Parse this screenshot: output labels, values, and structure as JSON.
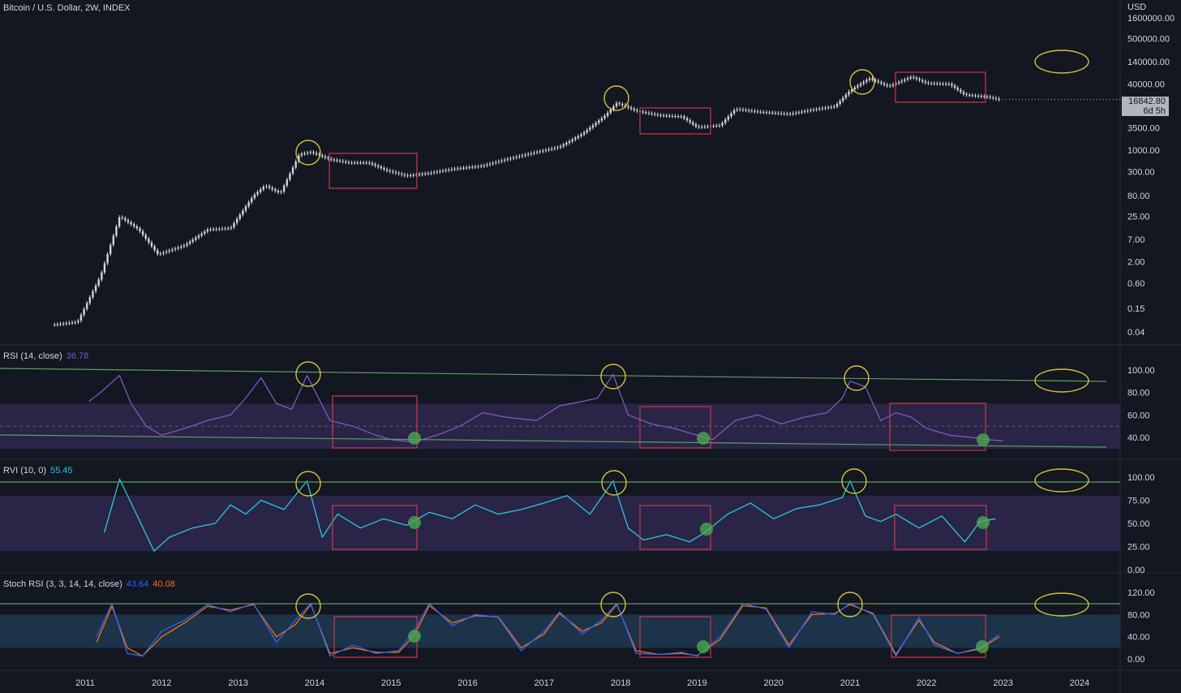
{
  "header": {
    "symbol_title": "Bitcoin / U.S. Dollar, 2W, INDEX",
    "currency": "USD",
    "last_price": "16842.80",
    "countdown": "6d 5h"
  },
  "colors": {
    "background": "#131722",
    "candle": "#d1d4dc",
    "rsi_line": "#7e57c2",
    "rvi_line": "#26c6da",
    "stoch_k": "#2962ff",
    "stoch_d": "#ff6d00",
    "trend_line": "#5b9b5b",
    "circle_highlight": "#d4c23a",
    "box_highlight": "#c93a45",
    "bottom_marker": "#4caf50",
    "band_fill": "#2a2547",
    "stoch_band_fill": "#1c3349"
  },
  "panes": {
    "rsi": {
      "label": "RSI (14, close)",
      "value": "36.78"
    },
    "rvi": {
      "label": "RVI (10, 0)",
      "value": "55.45"
    },
    "stoch": {
      "label": "Stoch RSI (3, 3, 14, 14, close)",
      "k_value": "43.64",
      "d_value": "40.08"
    }
  },
  "chart_data": [
    {
      "type": "line",
      "pane": "price",
      "title": "Bitcoin / U.S. Dollar, 2W, INDEX",
      "scale": "log",
      "y_ticks": [
        "1600000.00",
        "500000.00",
        "140000.00",
        "40000.00",
        "3500.00",
        "1000.00",
        "300.00",
        "80.00",
        "25.00",
        "7.00",
        "2.00",
        "0.60",
        "0.15",
        "0.04"
      ],
      "x_ticks": [
        "2011",
        "2012",
        "2013",
        "2014",
        "2015",
        "2016",
        "2017",
        "2018",
        "2019",
        "2020",
        "2021",
        "2022",
        "2023",
        "2024"
      ],
      "x": [
        2010.6,
        2010.9,
        2011.2,
        2011.45,
        2011.7,
        2011.95,
        2012.3,
        2012.6,
        2012.9,
        2013.2,
        2013.35,
        2013.55,
        2013.8,
        2013.95,
        2014.2,
        2014.45,
        2014.7,
        2014.95,
        2015.2,
        2015.5,
        2015.8,
        2016.2,
        2016.5,
        2016.9,
        2017.2,
        2017.5,
        2017.8,
        2017.95,
        2018.2,
        2018.5,
        2018.8,
        2019.0,
        2019.3,
        2019.5,
        2019.8,
        2020.2,
        2020.5,
        2020.8,
        2021.0,
        2021.25,
        2021.5,
        2021.8,
        2022.0,
        2022.3,
        2022.5,
        2022.8,
        2022.95
      ],
      "values": [
        0.06,
        0.07,
        0.9,
        25,
        12,
        3,
        5,
        12,
        13,
        80,
        140,
        90,
        800,
        900,
        600,
        500,
        500,
        320,
        240,
        280,
        350,
        420,
        600,
        900,
        1200,
        2500,
        7000,
        14000,
        9000,
        7000,
        6500,
        3600,
        4000,
        10000,
        8500,
        7500,
        9500,
        11500,
        28000,
        55000,
        35000,
        60000,
        42000,
        40000,
        22000,
        19500,
        16842.8
      ]
    },
    {
      "type": "line",
      "pane": "rsi",
      "title": "RSI (14, close)",
      "y_ticks": [
        "100.00",
        "80.00",
        "60.00",
        "40.00"
      ],
      "x": [
        2011.05,
        2011.2,
        2011.45,
        2011.6,
        2011.8,
        2012.0,
        2012.3,
        2012.6,
        2012.9,
        2013.1,
        2013.3,
        2013.5,
        2013.7,
        2013.9,
        2014.2,
        2014.5,
        2014.8,
        2015.0,
        2015.3,
        2015.6,
        2015.9,
        2016.2,
        2016.5,
        2016.9,
        2017.2,
        2017.5,
        2017.7,
        2017.9,
        2018.1,
        2018.4,
        2018.7,
        2019.0,
        2019.2,
        2019.5,
        2019.8,
        2020.1,
        2020.4,
        2020.7,
        2020.9,
        2021.0,
        2021.2,
        2021.4,
        2021.6,
        2021.8,
        2022.0,
        2022.3,
        2022.6,
        2022.8,
        2023.0
      ],
      "values": [
        72,
        80,
        95,
        70,
        50,
        42,
        48,
        55,
        60,
        75,
        93,
        70,
        65,
        95,
        55,
        50,
        42,
        38,
        36,
        42,
        50,
        62,
        58,
        55,
        68,
        72,
        75,
        96,
        60,
        52,
        48,
        42,
        38,
        55,
        60,
        52,
        58,
        62,
        75,
        90,
        85,
        55,
        62,
        58,
        48,
        42,
        40,
        38,
        37
      ]
    },
    {
      "type": "line",
      "pane": "rvi",
      "title": "RVI (10, 0)",
      "y_ticks": [
        "100.00",
        "75.00",
        "50.00",
        "25.00",
        "0.00"
      ],
      "x": [
        2011.25,
        2011.45,
        2011.7,
        2011.9,
        2012.1,
        2012.4,
        2012.7,
        2012.9,
        2013.1,
        2013.3,
        2013.6,
        2013.9,
        2014.1,
        2014.3,
        2014.6,
        2014.9,
        2015.2,
        2015.5,
        2015.8,
        2016.1,
        2016.4,
        2016.7,
        2017.0,
        2017.3,
        2017.6,
        2017.9,
        2018.1,
        2018.3,
        2018.6,
        2018.9,
        2019.1,
        2019.4,
        2019.7,
        2020.0,
        2020.3,
        2020.6,
        2020.9,
        2021.0,
        2021.2,
        2021.4,
        2021.6,
        2021.9,
        2022.2,
        2022.5,
        2022.7,
        2022.9
      ],
      "values": [
        40,
        98,
        55,
        20,
        35,
        45,
        50,
        70,
        60,
        75,
        65,
        96,
        35,
        60,
        45,
        55,
        48,
        62,
        55,
        70,
        60,
        65,
        72,
        80,
        60,
        96,
        45,
        32,
        38,
        30,
        40,
        60,
        72,
        55,
        66,
        70,
        78,
        96,
        58,
        52,
        60,
        45,
        58,
        30,
        52,
        55
      ]
    },
    {
      "type": "line",
      "pane": "stoch",
      "title": "Stoch RSI (3, 3, 14, 14, close)",
      "y_ticks": [
        "120.00",
        "80.00",
        "40.00",
        "0.00"
      ],
      "series": [
        {
          "name": "K",
          "x": [
            2011.15,
            2011.35,
            2011.55,
            2011.75,
            2012.0,
            2012.3,
            2012.6,
            2012.9,
            2013.2,
            2013.5,
            2013.75,
            2013.95,
            2014.2,
            2014.5,
            2014.8,
            2015.1,
            2015.3,
            2015.5,
            2015.8,
            2016.1,
            2016.4,
            2016.7,
            2017.0,
            2017.2,
            2017.5,
            2017.75,
            2017.95,
            2018.2,
            2018.5,
            2018.8,
            2019.0,
            2019.3,
            2019.6,
            2019.9,
            2020.2,
            2020.5,
            2020.8,
            2021.0,
            2021.3,
            2021.6,
            2021.9,
            2022.1,
            2022.4,
            2022.7,
            2022.95
          ],
          "values": [
            40,
            100,
            10,
            5,
            50,
            70,
            98,
            85,
            100,
            30,
            70,
            100,
            5,
            25,
            10,
            15,
            50,
            100,
            60,
            80,
            75,
            15,
            50,
            85,
            45,
            70,
            100,
            10,
            8,
            12,
            5,
            40,
            100,
            90,
            20,
            85,
            80,
            100,
            80,
            5,
            75,
            25,
            10,
            20,
            44
          ]
        },
        {
          "name": "D",
          "x": [
            2011.15,
            2011.35,
            2011.55,
            2011.75,
            2012.0,
            2012.3,
            2012.6,
            2012.9,
            2013.2,
            2013.5,
            2013.75,
            2013.95,
            2014.2,
            2014.5,
            2014.8,
            2015.1,
            2015.3,
            2015.5,
            2015.8,
            2016.1,
            2016.4,
            2016.7,
            2017.0,
            2017.2,
            2017.5,
            2017.75,
            2017.95,
            2018.2,
            2018.5,
            2018.8,
            2019.0,
            2019.3,
            2019.6,
            2019.9,
            2020.2,
            2020.5,
            2020.8,
            2021.0,
            2021.3,
            2021.6,
            2021.9,
            2022.1,
            2022.4,
            2022.7,
            2022.95
          ],
          "values": [
            30,
            95,
            20,
            5,
            40,
            65,
            95,
            88,
            98,
            40,
            62,
            98,
            10,
            20,
            12,
            12,
            42,
            96,
            65,
            78,
            76,
            20,
            45,
            82,
            50,
            65,
            98,
            15,
            8,
            10,
            6,
            35,
            96,
            92,
            25,
            80,
            82,
            98,
            82,
            8,
            70,
            30,
            10,
            18,
            40
          ]
        }
      ]
    }
  ]
}
